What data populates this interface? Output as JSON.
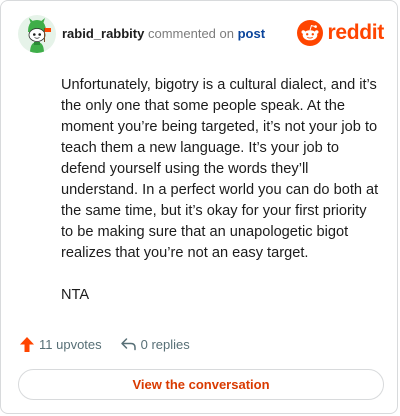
{
  "header": {
    "username": "rabid_rabbity",
    "action_text": "commented on",
    "target_link": "post",
    "brand_name": "reddit",
    "avatar_icon": "snoo-avatar-icon",
    "brand_icon": "reddit-logo-icon"
  },
  "comment": {
    "paragraphs": [
      "Unfortunately, bigotry is a cultural dialect, and it’s the only one that some people speak. At the moment you’re being targeted, it’s not your job to teach them a new language. It’s your job to defend yourself using the words they’ll understand. In a perfect world you can do both at the same time, but it’s okay for your first priority to be making sure that an unapologetic bigot realizes that you’re not an easy target.",
      "NTA"
    ]
  },
  "footer": {
    "upvotes_label": "11 upvotes",
    "replies_label": "0 replies",
    "upvote_icon": "upvote-arrow-icon",
    "reply_icon": "reply-arrow-icon"
  },
  "cta": {
    "label": "View the conversation"
  },
  "colors": {
    "brand": "#ff4500",
    "link": "#0a449b",
    "cta_text": "#d93a00",
    "muted": "#576f76",
    "border": "#d8dadc"
  }
}
